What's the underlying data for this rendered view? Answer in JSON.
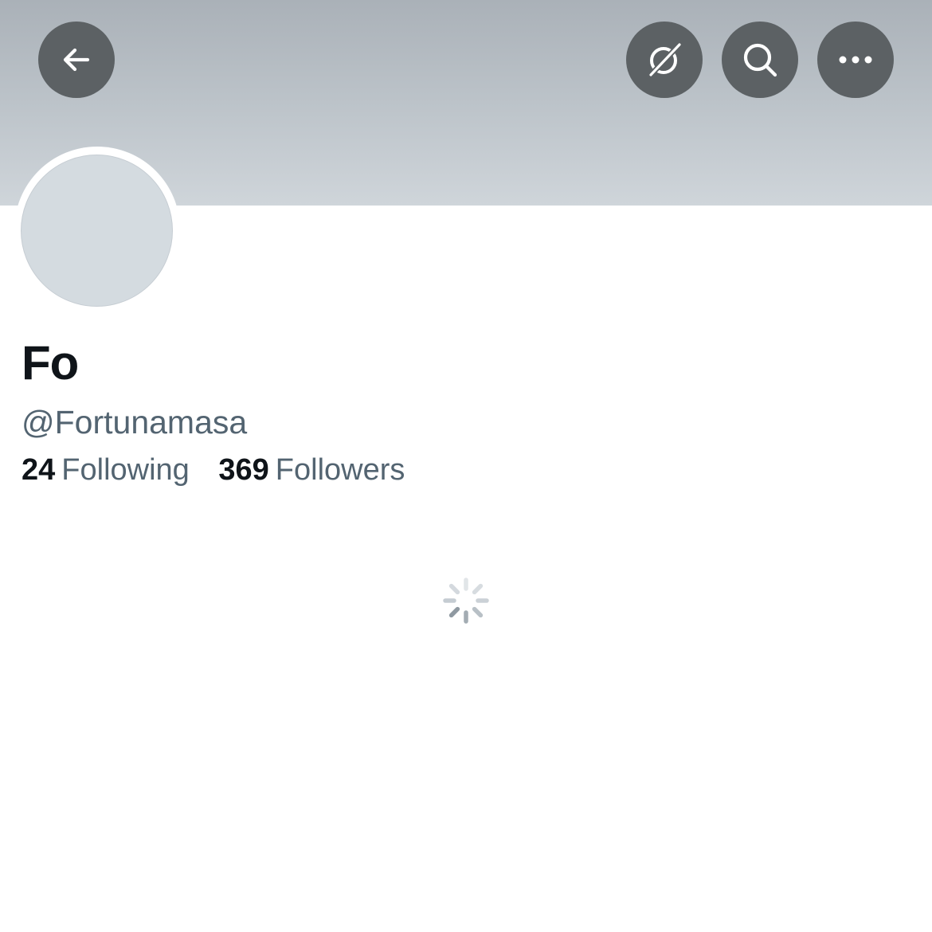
{
  "profile": {
    "display_name": "Fo",
    "handle": "@Fortunamasa"
  },
  "stats": {
    "following_count": "24",
    "following_label": "Following",
    "followers_count": "369",
    "followers_label": "Followers"
  },
  "header_buttons": {
    "back": "back-arrow-icon",
    "grok": "grok-icon",
    "search": "search-icon",
    "more": "more-options-icon"
  },
  "colors": {
    "banner": "#bcc3c9",
    "button_bg": "#5c6164",
    "primary_text": "#0f1419",
    "secondary_text": "#536471",
    "avatar_placeholder": "#d4dbe0"
  },
  "status": {
    "loading_icon": "loading-spinner-icon"
  }
}
